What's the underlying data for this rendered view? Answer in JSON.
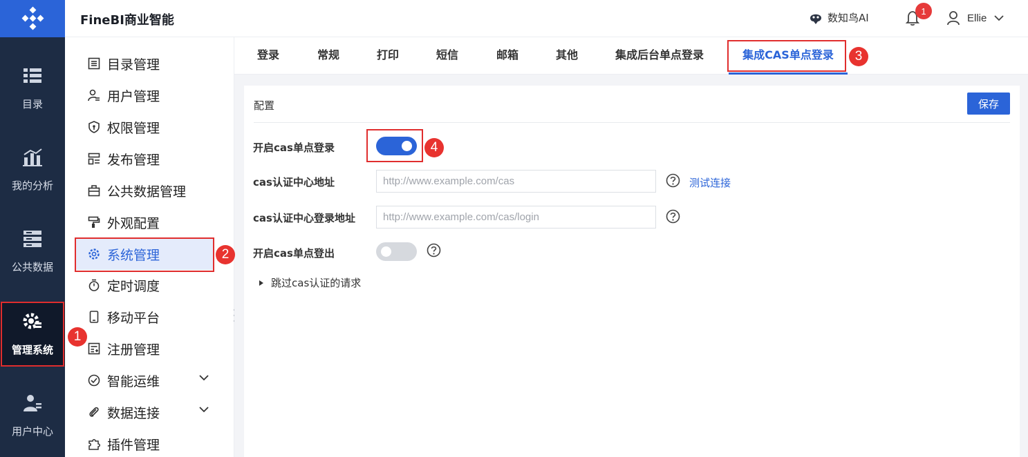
{
  "rail": {
    "items": [
      {
        "label": "目录",
        "icon": "catalog-icon"
      },
      {
        "label": "我的分析",
        "icon": "analysis-icon"
      },
      {
        "label": "公共数据",
        "icon": "public-data-icon"
      },
      {
        "label": "管理系统",
        "icon": "manage-system-icon"
      },
      {
        "label": "用户中心",
        "icon": "user-center-icon"
      }
    ]
  },
  "header": {
    "title": "FineBI商业智能",
    "ai_label": "数知鸟AI",
    "notification_count": "1",
    "username": "Ellie"
  },
  "menu": {
    "items": [
      {
        "label": "目录管理",
        "icon": "list-icon"
      },
      {
        "label": "用户管理",
        "icon": "user-list-icon"
      },
      {
        "label": "权限管理",
        "icon": "shield-icon"
      },
      {
        "label": "发布管理",
        "icon": "layout-icon"
      },
      {
        "label": "公共数据管理",
        "icon": "briefcase-icon"
      },
      {
        "label": "外观配置",
        "icon": "paint-roller-icon"
      },
      {
        "label": "系统管理",
        "icon": "gear-icon"
      },
      {
        "label": "定时调度",
        "icon": "stopwatch-icon"
      },
      {
        "label": "移动平台",
        "icon": "mobile-icon"
      },
      {
        "label": "注册管理",
        "icon": "register-icon"
      },
      {
        "label": "智能运维",
        "icon": "ops-icon"
      },
      {
        "label": "数据连接",
        "icon": "paperclip-icon"
      },
      {
        "label": "插件管理",
        "icon": "puzzle-icon"
      }
    ]
  },
  "tabs": [
    "登录",
    "常规",
    "打印",
    "短信",
    "邮箱",
    "其他",
    "集成后台单点登录",
    "集成CAS单点登录"
  ],
  "panel": {
    "title": "配置",
    "save_label": "保存",
    "enable_login_label": "开启cas单点登录",
    "enable_login": true,
    "server_url_label": "cas认证中心地址",
    "server_url_placeholder": "http://www.example.com/cas",
    "test_link": "测试连接",
    "login_url_label": "cas认证中心登录地址",
    "login_url_placeholder": "http://www.example.com/cas/login",
    "enable_logout_label": "开启cas单点登出",
    "enable_logout": false,
    "skip_label": "跳过cas认证的请求"
  },
  "annotations": [
    "1",
    "2",
    "3",
    "4"
  ],
  "colors": {
    "brand": "#2b64d8",
    "rail": "#1d2c44",
    "annotation": "#e02d2d"
  }
}
